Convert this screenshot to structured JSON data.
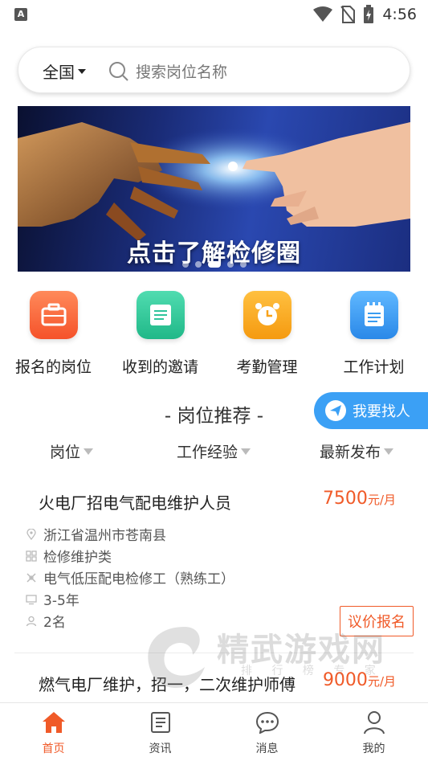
{
  "status_bar": {
    "time": "4:56",
    "app_badge": "A"
  },
  "search": {
    "region": "全国",
    "placeholder": "搜索岗位名称"
  },
  "banner": {
    "text": "点击了解检修圈",
    "dots": 5,
    "active_dot": 2
  },
  "quick_actions": [
    {
      "label": "报名的岗位",
      "icon": "briefcase-icon",
      "color": "#f8643a"
    },
    {
      "label": "收到的邀请",
      "icon": "document-icon",
      "color": "#2fc49c"
    },
    {
      "label": "考勤管理",
      "icon": "alarm-clock-icon",
      "color": "#f8a21a"
    },
    {
      "label": "工作计划",
      "icon": "notepad-icon",
      "color": "#3a9cf0"
    }
  ],
  "section": {
    "title": "- 岗位推荐 -",
    "find_button": "我要找人"
  },
  "filters": [
    "岗位",
    "工作经验",
    "最新发布"
  ],
  "jobs": [
    {
      "title": "火电厂招电气配电维护人员",
      "salary": "7500",
      "unit": "元/月",
      "location": "浙江省温州市苍南县",
      "category": "检修维护类",
      "skill": "电气低压配电检修工（熟练工）",
      "experience": "3-5年",
      "headcount": "2名",
      "action": "议价报名"
    },
    {
      "title": "燃气电厂维护，招一，二次维护师傅",
      "salary": "9000",
      "unit": "元/月"
    }
  ],
  "watermark": {
    "text": "精武游戏网",
    "sub": "排 行 榜 专 家"
  },
  "tabbar": [
    {
      "label": "首页",
      "icon": "home-icon",
      "active": true
    },
    {
      "label": "资讯",
      "icon": "news-icon",
      "active": false
    },
    {
      "label": "消息",
      "icon": "message-icon",
      "active": false
    },
    {
      "label": "我的",
      "icon": "profile-icon",
      "active": false
    }
  ],
  "colors": {
    "accent": "#f05a28",
    "blue": "#3ba0f5"
  }
}
